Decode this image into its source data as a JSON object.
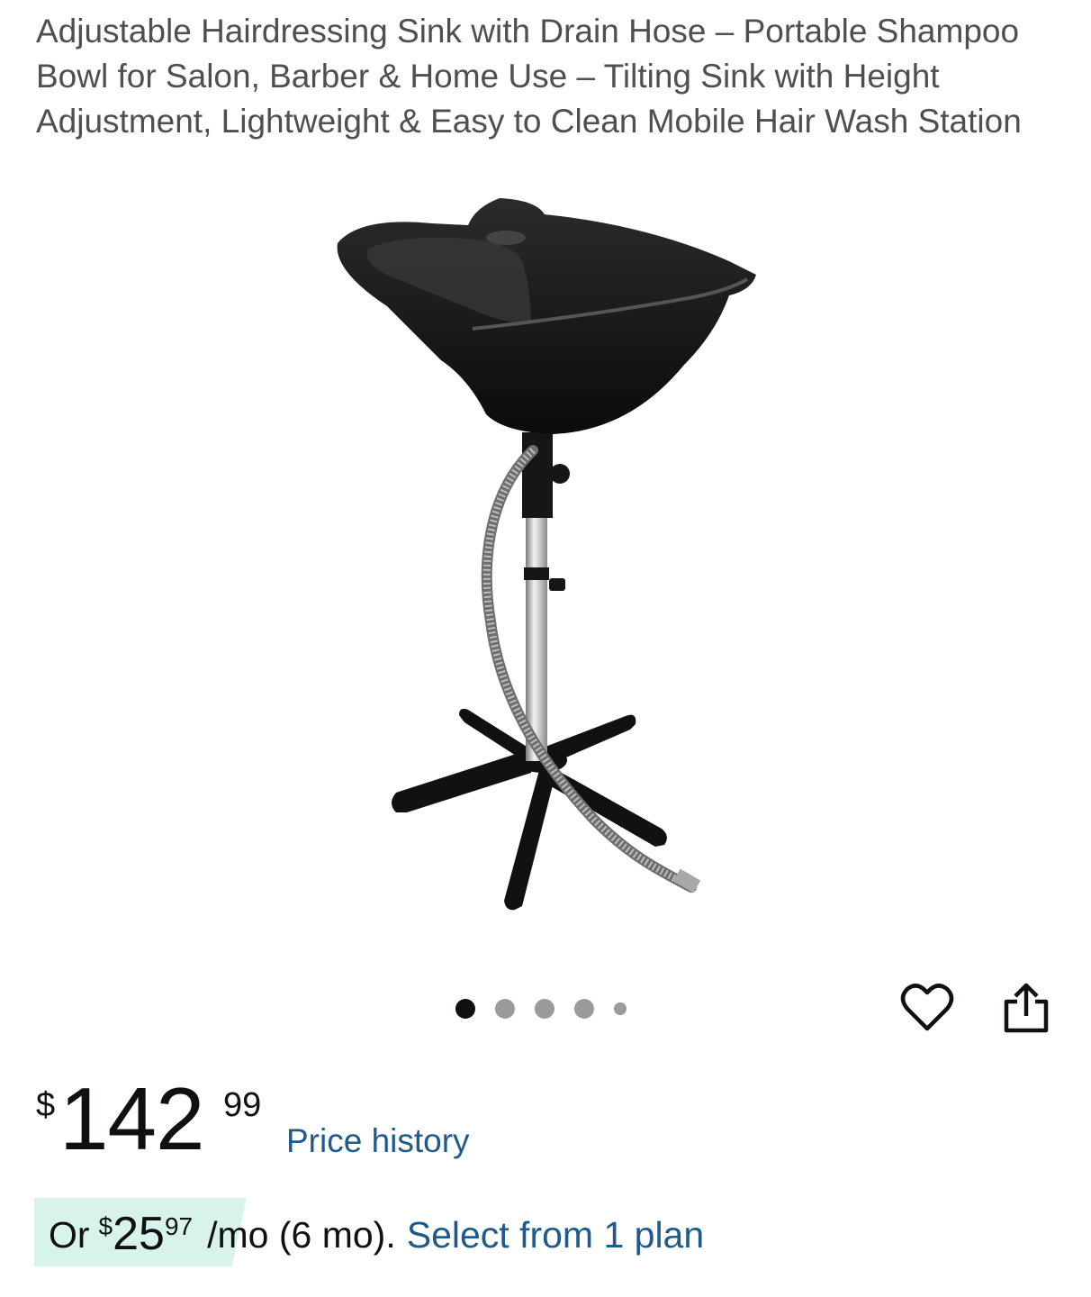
{
  "product": {
    "title": "Adjustable Hairdressing Sink with Drain Hose – Portable Shampoo Bowl for Salon, Barber & Home Use – Tilting Sink with Height Adjustment, Lightweight & Easy to Clean Mobile Hair Wash Station"
  },
  "gallery": {
    "image_count": 5,
    "active_index": 0
  },
  "icons": {
    "wishlist": "heart-outline-icon",
    "share": "share-icon"
  },
  "price": {
    "currency": "$",
    "whole": "142",
    "fraction": "99",
    "history_label": "Price history"
  },
  "installment": {
    "prefix": "Or",
    "currency": "$",
    "whole": "25",
    "fraction": "97",
    "term": "/mo (6 mo).",
    "link": "Select from 1 plan"
  },
  "colors": {
    "link": "#1f5a8c",
    "badge_bg": "#d8f3ec",
    "text": "#0f1111",
    "title_text": "#4f4f4f"
  }
}
